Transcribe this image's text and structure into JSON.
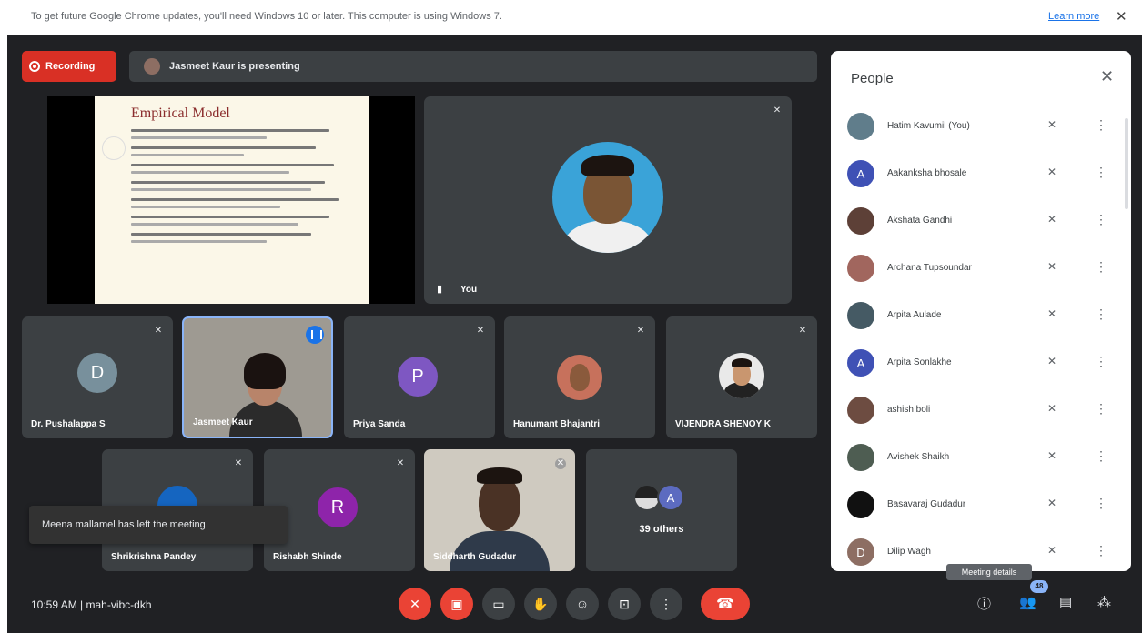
{
  "banner": {
    "message": "To get future Google Chrome updates, you'll need Windows 10 or later. This computer is using Windows 7.",
    "learn_more": "Learn more",
    "close": "✕"
  },
  "recording": {
    "label": "Recording"
  },
  "presenting": {
    "label": "Jasmeet Kaur is presenting"
  },
  "slide": {
    "title": "Empirical Model"
  },
  "you_tile": {
    "name": "You"
  },
  "tiles": [
    {
      "name": "Dr. Pushalappa S",
      "letter": "D",
      "color": "#78909c"
    },
    {
      "name": "Jasmeet Kaur"
    },
    {
      "name": "Priya Sanda",
      "letter": "P",
      "color": "#7e57c2"
    },
    {
      "name": "Hanumant Bhajantri"
    },
    {
      "name": "VIJENDRA SHENOY K"
    },
    {
      "name": "Shrikrishna Pandey",
      "color": "#1565c0"
    },
    {
      "name": "Rishabh Shinde",
      "letter": "R",
      "color": "#8e24aa"
    },
    {
      "name": "Siddharth Gudadur"
    },
    {
      "name": "39 others",
      "letter": "A",
      "color": "#5c6bc0"
    }
  ],
  "toast": {
    "message": "Meena mallamel has left the meeting"
  },
  "people": {
    "title": "People",
    "close": "✕",
    "list": [
      {
        "name": "Hatim Kavumil (You)",
        "color": "#607d8b"
      },
      {
        "name": "Aakanksha bhosale",
        "color": "#3f51b5",
        "letter": "A"
      },
      {
        "name": "Akshata Gandhi",
        "color": "#5d4037"
      },
      {
        "name": "Archana Tupsoundar",
        "color": "#a1665e"
      },
      {
        "name": "Arpita Aulade",
        "color": "#455a64"
      },
      {
        "name": "Arpita Sonlakhe",
        "color": "#3f51b5",
        "letter": "A"
      },
      {
        "name": "ashish boli",
        "color": "#6d4c41"
      },
      {
        "name": "Avishek Shaikh",
        "color": "#4e5d52"
      },
      {
        "name": "Basavaraj Gudadur",
        "color": "#111111"
      },
      {
        "name": "Dilip Wagh",
        "color": "#8d6e63",
        "letter": "D"
      }
    ]
  },
  "bottom": {
    "time": "10:59 AM  |  mah-vibc-dkh",
    "tooltip": "Meeting details",
    "participant_count": "48"
  }
}
